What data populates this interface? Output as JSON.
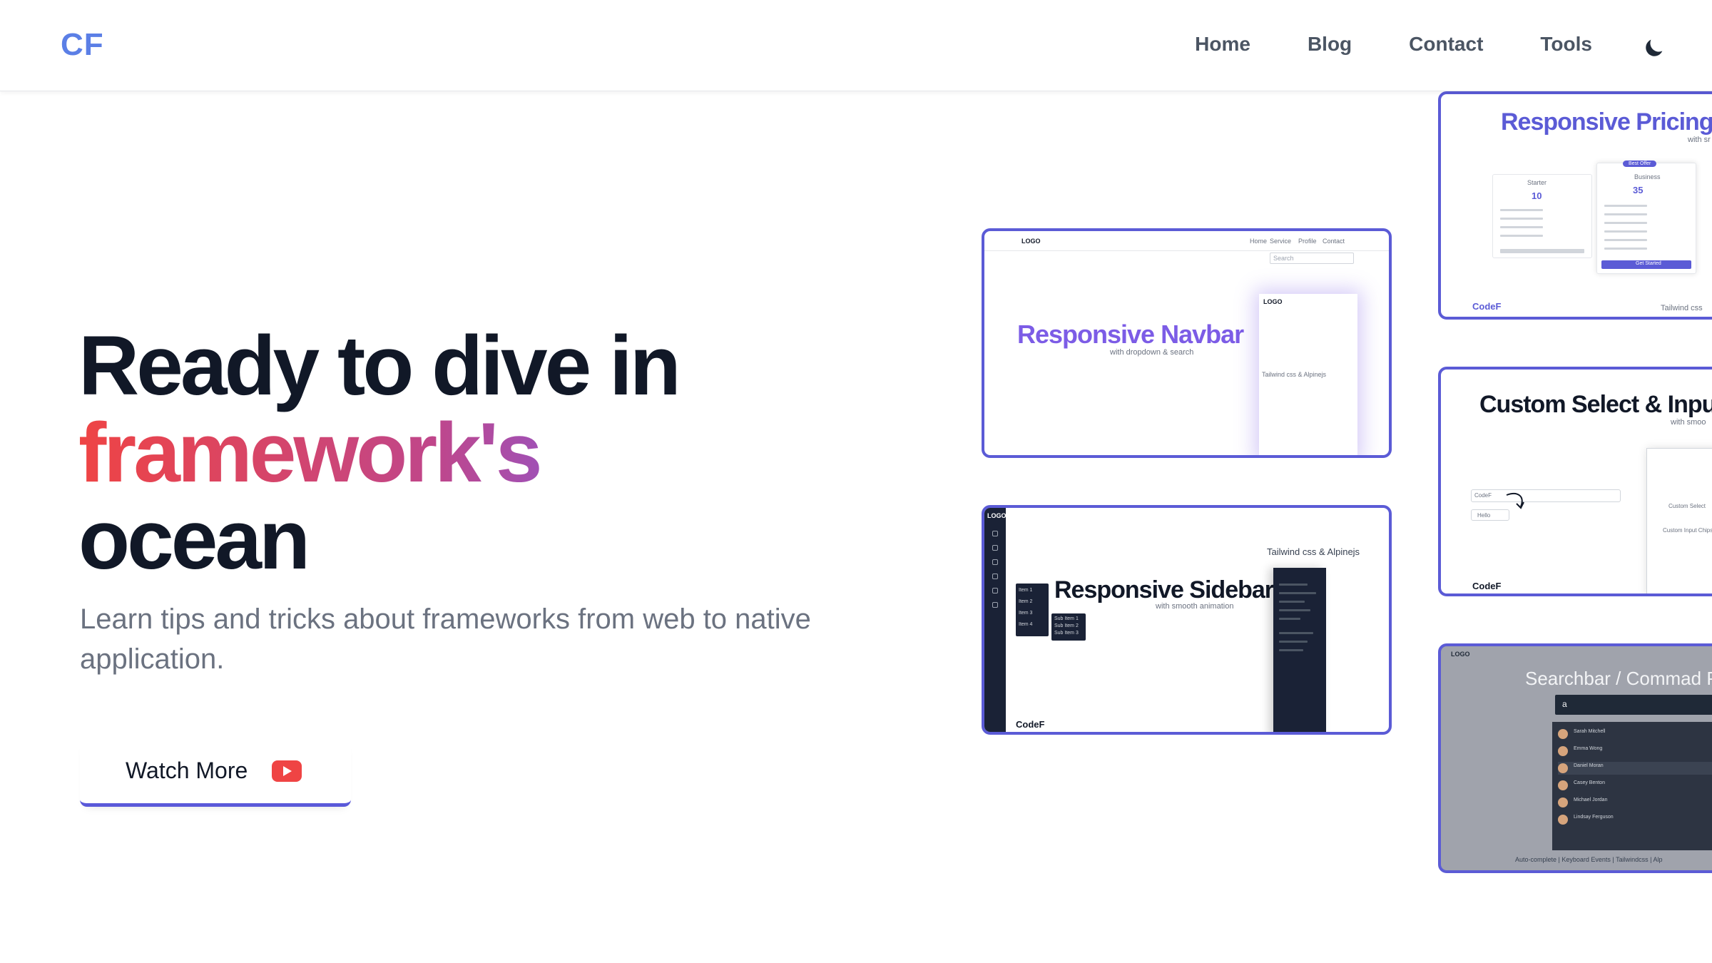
{
  "header": {
    "logo": "CF",
    "nav": [
      "Home",
      "Blog",
      "Contact",
      "Tools"
    ],
    "theme_icon": "moon-icon"
  },
  "hero": {
    "title_line1": "Ready to dive in",
    "title_line2": "framework's",
    "title_line3": "ocean",
    "subtitle": "Learn tips and tricks about frameworks from web to native application.",
    "button_label": "Watch More",
    "button_icon": "youtube-icon",
    "gradient": [
      "#ef4444",
      "#c0468a",
      "#7c5ce6",
      "#6366f1"
    ]
  },
  "thumbnails": [
    {
      "title": "Responsive Navbar",
      "subtitle": "with dropdown & search",
      "footer": "Tailwind css & Alpinejs",
      "logo": "LOGO",
      "menu": [
        "Home",
        "Service",
        "Profile",
        "Contact"
      ],
      "search_placeholder": "Search"
    },
    {
      "title": "Responsive Sidebar",
      "subtitle": "with smooth animation",
      "footer": "Tailwind css & Alpinejs",
      "brand": "CodeF",
      "logo": "LOGO",
      "items": [
        "Item 1",
        "Item 2",
        "Item 3",
        "Item 4"
      ],
      "sub_items": [
        "Sub Item 1",
        "Sub Item 2",
        "Sub Item 3"
      ]
    },
    {
      "title": "Responsive Pricing S",
      "subtitle": "with sr",
      "brand": "CodeF",
      "footer": "Tailwind css",
      "badge": "Best Offer",
      "plans": [
        {
          "name": "Starter",
          "price": "10"
        },
        {
          "name": "Business",
          "price": "35"
        }
      ],
      "cta": "Get Started"
    },
    {
      "title": "Custom Select & Input (",
      "subtitle": "with smoo",
      "brand": "CodeF",
      "input_value": "CodeF",
      "select_value": "Hello",
      "labels": [
        "Custom Select",
        "Custom Input Chips"
      ]
    },
    {
      "title": "Searchbar / Commad P",
      "logo": "LOGO",
      "query": "a",
      "footer": "Auto-complete | Keyboard Events | Tailwindcss | Alp",
      "results": [
        "Sarah Mitchell",
        "Emma Wong",
        "Daniel Moran",
        "Casey Benton",
        "Michael Jordan",
        "Lindsay Ferguson"
      ]
    }
  ]
}
